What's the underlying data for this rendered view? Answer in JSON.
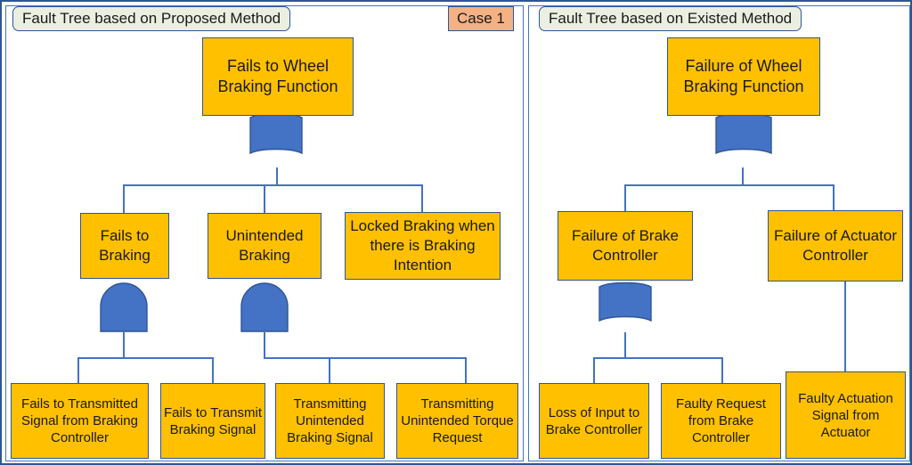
{
  "colors": {
    "node_fill": "#FFC000",
    "node_border": "#2F5597",
    "gate_fill": "#4472C4",
    "line": "#4472C4",
    "title_fill": "#EAEFE0",
    "case_fill": "#F4B183",
    "frame": "#2F5597",
    "background": "#FFFFFF"
  },
  "case_badge": {
    "label": "Case 1"
  },
  "left_panel": {
    "title": "Fault Tree based on Proposed Method",
    "nodes": {
      "top": "Fails to Wheel Braking Function",
      "mid1": "Fails to Braking",
      "mid2": "Unintended Braking",
      "mid3": "Locked Braking when there is Braking Intention",
      "leaf1": "Fails to Transmitted Signal from  Braking Controller",
      "leaf2": "Fails to Transmit Braking Signal",
      "leaf3": "Transmitting Unintended Braking Signal",
      "leaf4": "Transmitting Unintended Torque Request"
    },
    "gates": {
      "top_gate": "or-gate",
      "left_gate": "and-gate",
      "right_gate": "and-gate"
    }
  },
  "right_panel": {
    "title": "Fault Tree based on Existed Method",
    "nodes": {
      "top": "Failure of Wheel Braking Function",
      "mid1": "Failure of Brake Controller",
      "mid2": "Failure of Actuator Controller",
      "leaf1": "Loss of Input to Brake Controller",
      "leaf2": "Faulty Request from Brake Controller",
      "leaf3": "Faulty Actuation Signal from Actuator"
    },
    "gates": {
      "top_gate": "or-gate",
      "mid_gate": "or-gate"
    }
  }
}
